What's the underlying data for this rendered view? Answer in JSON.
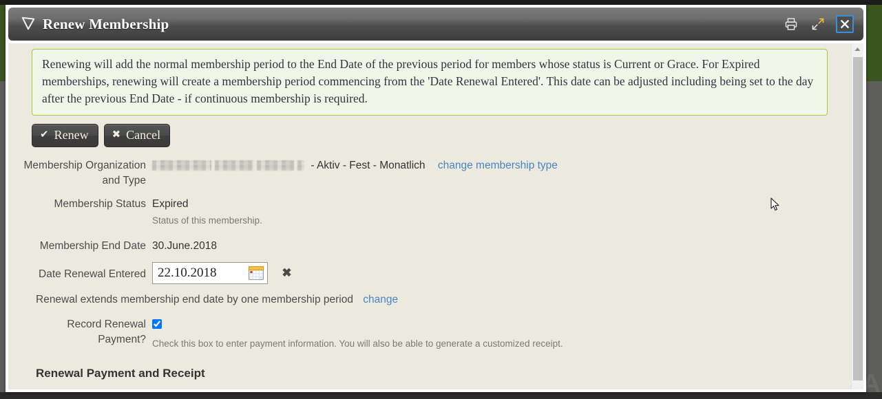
{
  "window": {
    "title": "Renew Membership",
    "icon": "shield-icon",
    "controls": [
      {
        "name": "print-icon",
        "label": "Print"
      },
      {
        "name": "expand-icon",
        "label": "Maximize"
      },
      {
        "name": "close-icon",
        "label": "Close"
      }
    ]
  },
  "notice": {
    "text": "Renewing will add the normal membership period to the End Date of the previous period for members whose status is Current or Grace. For Expired memberships, renewing will create a membership period commencing from the 'Date Renewal Entered'. This date can be adjusted including being set to the day after the previous End Date - if continuous membership is required.",
    "border_color": "#a2c93e",
    "background_color": "#f2f6e9"
  },
  "actions": {
    "renew_label": "Renew",
    "renew_icon": "check-icon",
    "cancel_label": "Cancel",
    "cancel_icon": "x-icon"
  },
  "form": {
    "organization": {
      "label_line1": "Membership Organization",
      "label_line2": "and Type",
      "name_redacted": true,
      "separator": "-",
      "type": "Aktiv - Fest - Monatlich",
      "change_link": "change membership type"
    },
    "status": {
      "label": "Membership Status",
      "value": "Expired",
      "hint": "Status of this membership."
    },
    "end_date": {
      "label": "Membership End Date",
      "value": "30.June.2018"
    },
    "renewal_date": {
      "label": "Date Renewal Entered",
      "value": "22.10.2018",
      "placeholder": "",
      "calendar_icon": "calendar-icon",
      "clear_icon": "x-icon"
    },
    "period_note": {
      "text": "Renewal extends membership end date by one membership period",
      "change_link": "change"
    },
    "record_payment": {
      "label_line1": "Record Renewal",
      "label_line2": "Payment?",
      "checked": true,
      "hint": "Check this box to enter payment information. You will also be able to generate a customized receipt."
    }
  },
  "section": {
    "heading": "Renewal Payment and Receipt"
  },
  "background": {
    "letter": "A"
  },
  "colors": {
    "accent_link": "#4a84c4",
    "notice_border": "#a2c93e",
    "page_bg": "#eceade",
    "titlebar": "#4e4e4e",
    "focus_outline": "#3b8fe0"
  }
}
